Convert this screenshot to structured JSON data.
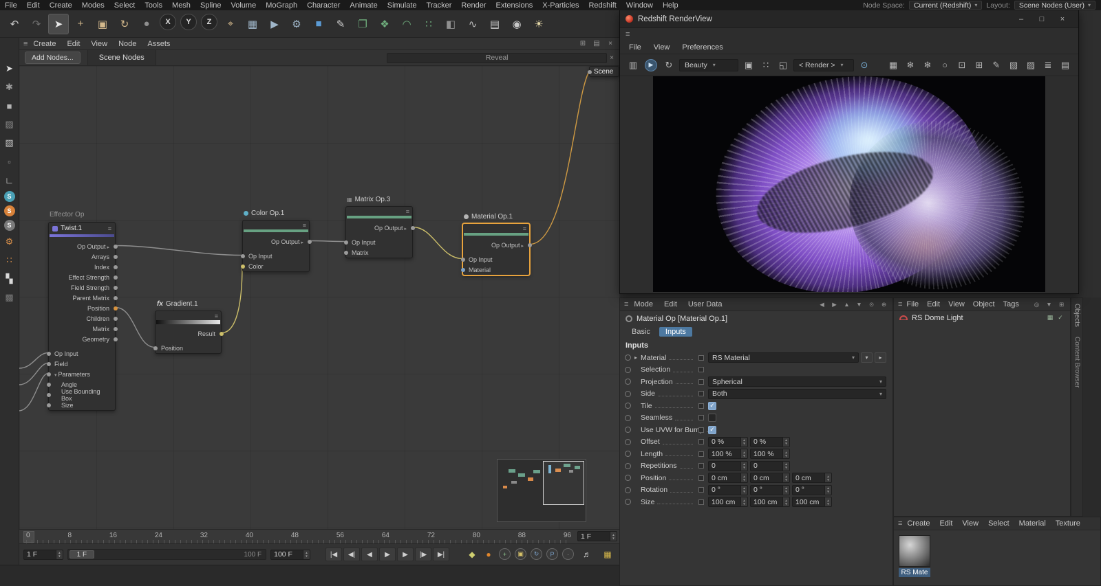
{
  "icons": {
    "hamburger": "≡",
    "close": "×",
    "caret_down": "▾",
    "caret_right": "▸",
    "check": "✓",
    "minimize": "–",
    "maximize": "□"
  },
  "colors": {
    "selection_orange": "#e8a33d",
    "wire_gray": "#8f8f8f",
    "wire_yellow": "#cdbf6a",
    "wire_orange": "#cf9a43",
    "strip_green": "#67a182",
    "strip_blue": "#7b74d8",
    "checkbox_blue": "#7fa3c9"
  },
  "menubar": {
    "items": [
      "File",
      "Edit",
      "Create",
      "Modes",
      "Select",
      "Tools",
      "Mesh",
      "Spline",
      "Volume",
      "MoGraph",
      "Character",
      "Animate",
      "Simulate",
      "Tracker",
      "Render",
      "Extensions",
      "X-Particles",
      "Redshift",
      "Window",
      "Help"
    ],
    "node_space_label": "Node Space:",
    "node_space_value": "Current (Redshift)",
    "layout_label": "Layout:",
    "layout_value": "Scene Nodes (User)"
  },
  "main_toolbar": {
    "icons": [
      {
        "name": "undo-icon",
        "glyph": "↶",
        "color": "#c8c8c8"
      },
      {
        "name": "redo-icon",
        "glyph": "↷",
        "color": "#6f6f6f"
      },
      {
        "name": "live-selection-icon",
        "glyph": "➤",
        "color": "#e8e8e8",
        "cls": "active"
      },
      {
        "name": "move-tool-icon",
        "glyph": "+",
        "color": "#d4b98c"
      },
      {
        "name": "scale-tool-icon",
        "glyph": "▣",
        "color": "#d4b98c"
      },
      {
        "name": "rotate-tool-icon",
        "glyph": "↻",
        "color": "#d4b98c"
      },
      {
        "name": "last-tool-icon",
        "glyph": "●",
        "color": "#8f8f8f"
      },
      {
        "name": "axis-x-button",
        "glyph": "X",
        "cls": "axis"
      },
      {
        "name": "axis-y-button",
        "glyph": "Y",
        "cls": "axis"
      },
      {
        "name": "axis-z-button",
        "glyph": "Z",
        "cls": "axis"
      },
      {
        "name": "coord-system-icon",
        "glyph": "⌖",
        "color": "#d4b98c"
      },
      {
        "name": "render-view-icon",
        "glyph": "▦",
        "color": "#9fb6c9"
      },
      {
        "name": "render-to-picture-icon",
        "glyph": "▶",
        "color": "#9fb6c9"
      },
      {
        "name": "render-settings-icon",
        "glyph": "⚙",
        "color": "#9fb6c9"
      },
      {
        "name": "add-cube-icon",
        "glyph": "■",
        "color": "#5b9bd5"
      },
      {
        "name": "pen-tool-icon",
        "glyph": "✎",
        "color": "#cccccc"
      },
      {
        "name": "instance-icon",
        "glyph": "❐",
        "color": "#6fae7d"
      },
      {
        "name": "mograph-icon",
        "glyph": "❖",
        "color": "#6fae7d"
      },
      {
        "name": "bend-deformer-icon",
        "glyph": "◠",
        "color": "#6fae7d"
      },
      {
        "name": "array-icon",
        "glyph": "∷",
        "color": "#6fae7d"
      },
      {
        "name": "fields-icon",
        "glyph": "◧",
        "color": "#8f8f8f"
      },
      {
        "name": "spline-modifier-icon",
        "glyph": "∿",
        "color": "#bdbdbd"
      },
      {
        "name": "floor-icon",
        "glyph": "▤",
        "color": "#c8c8c8"
      },
      {
        "name": "camera-icon",
        "glyph": "◉",
        "color": "#c8c8c8"
      },
      {
        "name": "light-icon",
        "glyph": "☀",
        "color": "#e6d9a8"
      }
    ]
  },
  "side_toolbar": {
    "icons": [
      {
        "name": "select-pen-icon",
        "glyph": "➤",
        "color": "#e0e0e0"
      },
      {
        "name": "sculpt-icon",
        "glyph": "✱",
        "color": "#9a9a9a"
      },
      {
        "name": "model-mode-icon",
        "glyph": "■",
        "color": "#b5b5b5"
      },
      {
        "name": "texture-mode-icon",
        "glyph": "▨",
        "color": "#8b8b8b"
      },
      {
        "name": "workplane-icon",
        "glyph": "▧",
        "color": "#c5c5c5"
      },
      {
        "name": "points-mode-icon",
        "glyph": "▫",
        "color": "#9a9a9a"
      },
      {
        "name": "ax-mode-icon",
        "glyph": "∟",
        "color": "#e0e0e0"
      },
      {
        "name": "tag-phong-icon",
        "glyph": "S",
        "cls": "badge badge-teal"
      },
      {
        "name": "tag-selection-icon",
        "glyph": "S",
        "cls": "badge badge-orange"
      },
      {
        "name": "tag-material-icon",
        "glyph": "S",
        "cls": "badge badge-gray"
      },
      {
        "name": "tweak-icon",
        "glyph": "⚙",
        "color": "#d88f4a"
      },
      {
        "name": "dots-grid-icon",
        "glyph": "∷",
        "color": "#d88f4a"
      },
      {
        "name": "checker-icon",
        "glyph": "▚",
        "color": "#d8d8d8"
      },
      {
        "name": "snap-icon",
        "glyph": "▩",
        "color": "#7a7a7a"
      }
    ]
  },
  "node_editor": {
    "menu": [
      "Create",
      "Edit",
      "View",
      "Node",
      "Assets"
    ],
    "window_icons": [
      {
        "name": "dock-icon",
        "glyph": "⊞"
      },
      {
        "name": "layout-icon",
        "glyph": "▤"
      },
      {
        "name": "close-icon",
        "glyph": "×"
      }
    ],
    "add_nodes": "Add Nodes...",
    "tab": "Scene Nodes",
    "search_value": "Reveal",
    "nodes": {
      "twist": {
        "category": "Effector Op",
        "title": "Twist.1",
        "outputs": [
          "Op Output",
          "Arrays",
          "Index",
          "Effect Strength",
          "Field Strength",
          "Parent Matrix",
          "Position",
          "Children",
          "Matrix",
          "Geometry"
        ],
        "inputs": [
          "Op Input",
          "Field",
          "Parameters",
          "Angle",
          "Use Bounding Box",
          "Size"
        ]
      },
      "gradient": {
        "title": "Gradient.1",
        "outputs": [
          "Result"
        ],
        "inputs": [
          "Position"
        ]
      },
      "color": {
        "title": "Color Op.1",
        "outputs": [
          "Op Output"
        ],
        "inputs": [
          "Op Input",
          "Color"
        ]
      },
      "matrix": {
        "title": "Matrix Op.3",
        "outputs": [
          "Op Output"
        ],
        "inputs": [
          "Op Input",
          "Matrix"
        ]
      },
      "material": {
        "title": "Material Op.1",
        "outputs": [
          "Op Output"
        ],
        "inputs": [
          "Op Input",
          "Material"
        ]
      },
      "scene": {
        "title": "Scene"
      }
    }
  },
  "timeline": {
    "ticks": [
      "0",
      "8",
      "16",
      "24",
      "32",
      "40",
      "48",
      "56",
      "64",
      "72",
      "80",
      "88",
      "96"
    ],
    "end_frame": "1 F",
    "current_frame": "1 F",
    "range_handle": "1 F",
    "range_end": "100 F",
    "range_end_field": "100 F",
    "transport": [
      {
        "name": "goto-start-button",
        "glyph": "|◀"
      },
      {
        "name": "prev-key-button",
        "glyph": "◀|"
      },
      {
        "name": "prev-frame-button",
        "glyph": "◀"
      },
      {
        "name": "play-button",
        "glyph": "▶"
      },
      {
        "name": "next-frame-button",
        "glyph": "▶"
      },
      {
        "name": "next-key-button",
        "glyph": "|▶"
      },
      {
        "name": "goto-end-button",
        "glyph": "▶|"
      }
    ],
    "record": [
      {
        "name": "set-key-icon",
        "glyph": "◆",
        "color": "#cfcf70"
      },
      {
        "name": "autokey-icon",
        "glyph": "●",
        "color": "#e0862c"
      },
      {
        "name": "record-position-icon",
        "glyph": "+",
        "cls": "circ",
        "color": "#8fc98f"
      },
      {
        "name": "record-scale-icon",
        "glyph": "▣",
        "cls": "circ",
        "color": "#d8c36a"
      },
      {
        "name": "record-rotation-icon",
        "glyph": "↻",
        "cls": "circ",
        "color": "#7aa0c8"
      },
      {
        "name": "record-parameter-icon",
        "glyph": "P",
        "cls": "circ",
        "color": "#7aa0c8"
      },
      {
        "name": "record-pla-icon",
        "glyph": "·",
        "cls": "circ",
        "color": "#999999"
      }
    ],
    "right_icons": [
      {
        "name": "sound-icon",
        "glyph": "♬",
        "color": "#e0e0e0"
      },
      {
        "name": "ram-player-icon",
        "glyph": "▦",
        "color": "#d4b64a"
      }
    ]
  },
  "renderview": {
    "title": "Redshift RenderView",
    "window_buttons": [
      {
        "name": "minimize-button",
        "glyph": "–"
      },
      {
        "name": "maximize-button",
        "glyph": "□"
      },
      {
        "name": "close-button",
        "glyph": "×"
      }
    ],
    "menu": [
      "File",
      "View",
      "Preferences"
    ],
    "left_icons": [
      {
        "name": "snapshot-strip-icon",
        "glyph": "▥"
      },
      {
        "name": "start-ipr-button",
        "glyph": "▶",
        "cls": "blue-circ"
      },
      {
        "name": "refresh-icon",
        "glyph": "↻"
      }
    ],
    "beauty_value": "Beauty",
    "mid_icons": [
      {
        "name": "aov-icon",
        "glyph": "▣"
      },
      {
        "name": "dither-icon",
        "glyph": "∷"
      },
      {
        "name": "crop-icon",
        "glyph": "◱"
      }
    ],
    "render_mode": "< Render >",
    "lock_icon": {
      "name": "lock-icon",
      "glyph": "⊙",
      "color": "#7ab0d8"
    },
    "right_icons": [
      {
        "name": "grid-icon",
        "glyph": "▦"
      },
      {
        "name": "snapshot-icon",
        "glyph": "❄"
      },
      {
        "name": "snapshot-compare-icon",
        "glyph": "❄"
      },
      {
        "name": "region-icon",
        "glyph": "○"
      },
      {
        "name": "expand-icon",
        "glyph": "⊡"
      },
      {
        "name": "fit-icon",
        "glyph": "⊞"
      },
      {
        "name": "annotate-icon",
        "glyph": "✎"
      },
      {
        "name": "save-image-icon",
        "glyph": "▧"
      },
      {
        "name": "compare-icon",
        "glyph": "▨"
      },
      {
        "name": "layers-icon",
        "glyph": "≣"
      },
      {
        "name": "panel-icon",
        "glyph": "▤"
      }
    ]
  },
  "attributes": {
    "menu": [
      "Mode",
      "Edit",
      "User Data"
    ],
    "header_icons": [
      {
        "name": "back-icon",
        "glyph": "◀"
      },
      {
        "name": "forward-icon",
        "glyph": "▶"
      },
      {
        "name": "up-icon",
        "glyph": "▲"
      },
      {
        "name": "filter-icon",
        "glyph": "▼"
      },
      {
        "name": "lock-icon",
        "glyph": "⊙"
      },
      {
        "name": "new-panel-icon",
        "glyph": "⊕"
      }
    ],
    "title": "Material Op [Material Op.1]",
    "tabs": [
      "Basic",
      "Inputs"
    ],
    "section": "Inputs",
    "rows": {
      "material": {
        "label": "Material",
        "value": "RS Material"
      },
      "selection": {
        "label": "Selection"
      },
      "projection": {
        "label": "Projection",
        "value": "Spherical"
      },
      "side": {
        "label": "Side",
        "value": "Both"
      },
      "tile": {
        "label": "Tile",
        "check": "✓"
      },
      "seamless": {
        "label": "Seamless",
        "check": ""
      },
      "uvw": {
        "label": "Use UVW for Bump",
        "check": "✓"
      },
      "offset": {
        "label": "Offset",
        "values": [
          "0 %",
          "0 %"
        ]
      },
      "length": {
        "label": "Length",
        "values": [
          "100 %",
          "100 %"
        ]
      },
      "repetitions": {
        "label": "Repetitions",
        "values": [
          "0",
          "0"
        ]
      },
      "position": {
        "label": "Position",
        "values": [
          "0 cm",
          "0 cm",
          "0 cm"
        ]
      },
      "rotation": {
        "label": "Rotation",
        "values": [
          "0 °",
          "0 °",
          "0 °"
        ]
      },
      "size": {
        "label": "Size",
        "values": [
          "100 cm",
          "100 cm",
          "100 cm"
        ]
      }
    }
  },
  "object_manager": {
    "menu": [
      "File",
      "Edit",
      "View",
      "Object",
      "Tags"
    ],
    "header_icons": [
      {
        "name": "search-icon",
        "glyph": "◎"
      },
      {
        "name": "filter-icon",
        "glyph": "▼"
      },
      {
        "name": "add-icon",
        "glyph": "⊞"
      }
    ],
    "item": "RS Dome Light",
    "item_tags": [
      {
        "name": "texture-tag-icon",
        "glyph": "▦"
      },
      {
        "name": "enabled-check-icon",
        "glyph": "✓"
      }
    ]
  },
  "side_tabs": [
    "Objects",
    "Content Browser"
  ],
  "material_manager": {
    "menu": [
      "Create",
      "Edit",
      "View",
      "Select",
      "Material",
      "Texture"
    ],
    "material_name": "RS Mate"
  }
}
